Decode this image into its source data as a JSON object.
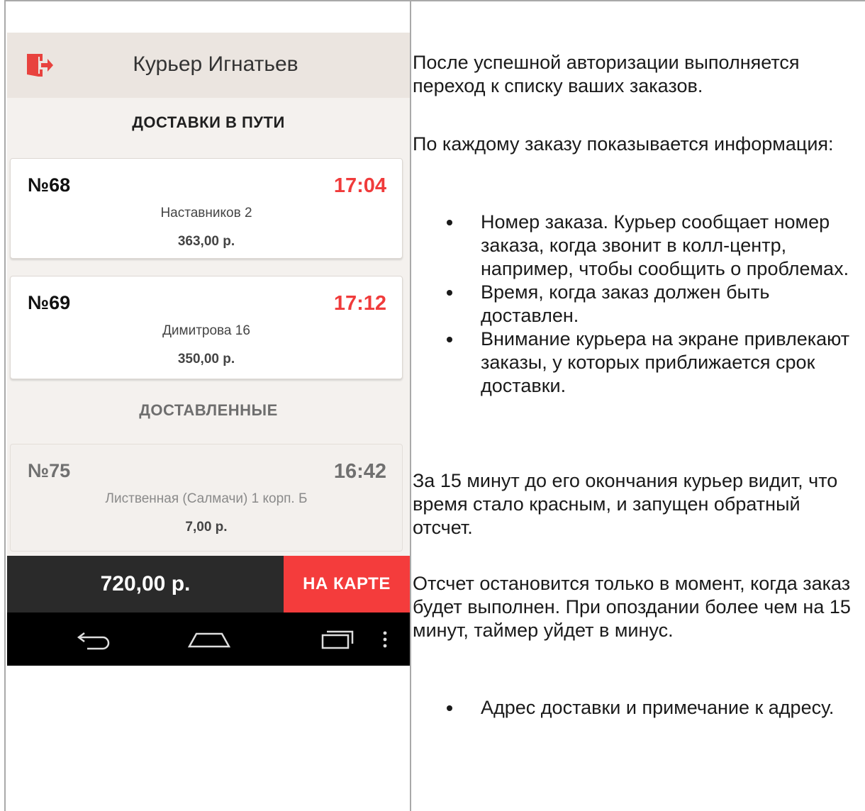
{
  "app": {
    "title": "Курьер Игнатьев",
    "section_active": "ДОСТАВКИ В ПУТИ",
    "section_done": "ДОСТАВЛЕННЫЕ",
    "orders_active": [
      {
        "number": "№68",
        "time": "17:04",
        "address": "Наставников 2",
        "sum": "363,00 р."
      },
      {
        "number": "№69",
        "time": "17:12",
        "address": "Димитрова 16",
        "sum": "350,00 р."
      }
    ],
    "orders_done": [
      {
        "number": "№75",
        "time": "16:42",
        "address": "Лиственная (Салмачи) 1 корп. Б",
        "sum": "7,00 р."
      }
    ],
    "total": "720,00 р.",
    "map_button": "НА КАРТЕ",
    "colors": {
      "accent": "#f43c3c",
      "appbar": "#ebe5e0",
      "background": "#f4f1ee",
      "bottombar": "#2a2a2a"
    }
  },
  "doc": {
    "p1": "После успешной авторизации выполняется переход к списку ваших заказов.",
    "p2": "По каждому заказу показывается информация:",
    "list1": [
      "Номер заказа. Курьер сообщает номер заказа, когда звонит в колл-центр, например, чтобы сообщить о проблемах.",
      "Время, когда заказ должен быть доставлен.",
      "Внимание курьера на экране привлекают заказы, у которых приближается срок доставки."
    ],
    "p3": "За 15 минут до его окончания курьер видит, что время стало красным, и запущен обратный отсчет.",
    "p4": "Отсчет остановится только в момент, когда заказ будет выполнен. При опоздании более чем на 15 минут, таймер уйдет в минус.",
    "list2": [
      "Адрес доставки и примечание к адресу."
    ]
  }
}
